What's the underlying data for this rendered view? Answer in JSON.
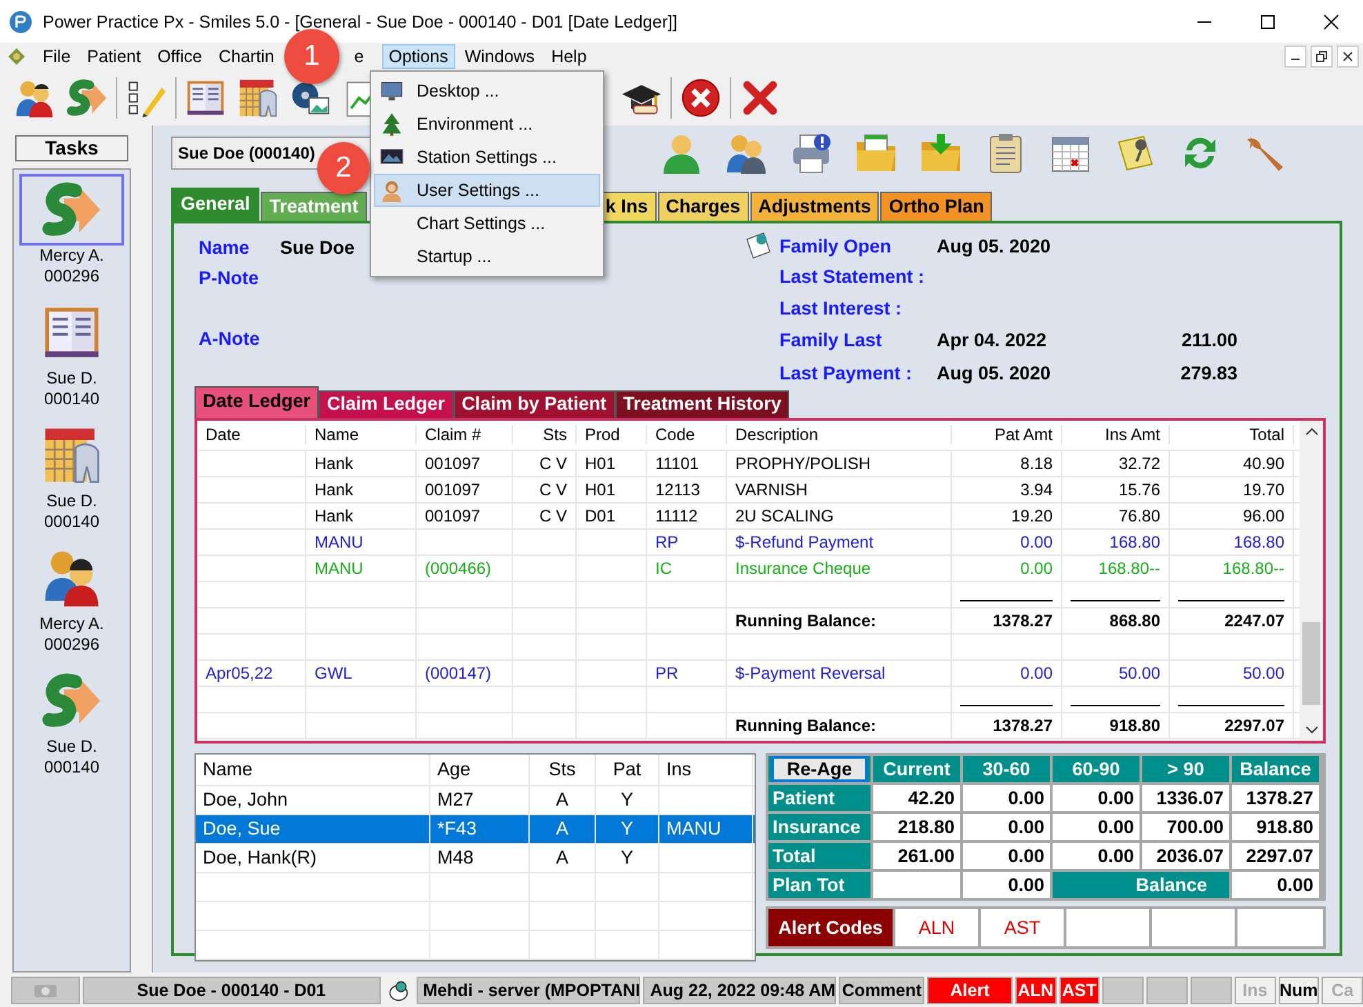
{
  "window": {
    "title": "Power Practice Px - Smiles 5.0 - [General - Sue Doe - 000140 - D01 [Date Ledger]]"
  },
  "menu": [
    {
      "label": "File",
      "selected": false
    },
    {
      "label": "Patient",
      "selected": false
    },
    {
      "label": "Office",
      "selected": false
    },
    {
      "label": "Chartin",
      "selected": false
    },
    {
      "label": "e",
      "selected": false
    },
    {
      "label": "Options",
      "selected": true
    },
    {
      "label": "Windows",
      "selected": false
    },
    {
      "label": "Help",
      "selected": false
    }
  ],
  "options_menu": {
    "items": [
      {
        "label": "Desktop ...",
        "selected": false
      },
      {
        "label": "Environment ...",
        "selected": false
      },
      {
        "label": "Station Settings ...",
        "selected": false
      },
      {
        "label": "User Settings ...",
        "selected": true
      },
      {
        "label": "Chart Settings ...",
        "selected": false
      },
      {
        "label": "Startup ...",
        "selected": false
      }
    ]
  },
  "callouts": [
    {
      "number": "1"
    },
    {
      "number": "2"
    }
  ],
  "tasks": {
    "title": "Tasks",
    "items": [
      {
        "kind": "payment",
        "name": "Mercy A.",
        "number": "000296",
        "selected": true
      },
      {
        "kind": "ledger",
        "name": "Sue D.",
        "number": "000140",
        "selected": false
      },
      {
        "kind": "chart",
        "name": "Sue D.",
        "number": "000140",
        "selected": false
      },
      {
        "kind": "family",
        "name": "Mercy A.",
        "number": "000296",
        "selected": false
      },
      {
        "kind": "payment",
        "name": "Sue D.",
        "number": "000140",
        "selected": false
      }
    ]
  },
  "patient_select": {
    "value": "Sue Doe (000140)"
  },
  "tabs": [
    {
      "label": "General",
      "selected": true,
      "color": "#2e8b2e"
    },
    {
      "label": "Treatment",
      "selected": false,
      "color": "#62ad52"
    },
    {
      "label": "k Ins",
      "selected": false,
      "color": "#f0d860"
    },
    {
      "label": "Charges",
      "selected": false,
      "color": "#f0d060"
    },
    {
      "label": "Adjustments",
      "selected": false,
      "color": "#f5b23a"
    },
    {
      "label": "Ortho Plan",
      "selected": false,
      "color": "#f39224"
    }
  ],
  "patient_info": {
    "name_label": "Name",
    "name": "Sue Doe",
    "p_note_label": "P-Note",
    "a_note_label": "A-Note",
    "summary": [
      {
        "label": "Family Open",
        "date": "Aug 05. 2020"
      },
      {
        "label": "Last Statement :"
      },
      {
        "label": "Last Interest :"
      },
      {
        "label": "Family Last",
        "date": "Apr 04. 2022",
        "amount": "211.00"
      },
      {
        "label": "Last Payment :",
        "date": "Aug 05. 2020",
        "amount": "279.83"
      }
    ]
  },
  "ledger_tabs": [
    {
      "label": "Date Ledger",
      "selected": true,
      "color": "#e8507c"
    },
    {
      "label": "Claim Ledger",
      "selected": false,
      "color": "#c4104c"
    },
    {
      "label": "Claim by Patient",
      "selected": false,
      "color": "#a01030"
    },
    {
      "label": "Treatment History",
      "selected": false,
      "color": "#7c1020"
    }
  ],
  "ledger": {
    "columns": [
      "Date",
      "Name",
      "Claim #",
      "Sts",
      "Prod",
      "Code",
      "Description",
      "Pat Amt",
      "Ins Amt",
      "Total"
    ],
    "rows": [
      {
        "kind": "entry",
        "color": "#000000",
        "name": "Hank",
        "claim": "001097",
        "sts": "C V",
        "prod": "H01",
        "code": "11101",
        "description": "PROPHY/POLISH",
        "pat": "8.18",
        "ins": "32.72",
        "total": "40.90"
      },
      {
        "kind": "entry",
        "color": "#000000",
        "name": "Hank",
        "claim": "001097",
        "sts": "C V",
        "prod": "H01",
        "code": "12113",
        "description": "VARNISH",
        "pat": "3.94",
        "ins": "15.76",
        "total": "19.70"
      },
      {
        "kind": "entry",
        "color": "#000000",
        "name": "Hank",
        "claim": "001097",
        "sts": "C V",
        "prod": "D01",
        "code": "11112",
        "description": "2U SCALING",
        "pat": "19.20",
        "ins": "76.80",
        "total": "96.00"
      },
      {
        "kind": "entry",
        "color": "#2020d0",
        "name": "MANU",
        "code": "RP",
        "description": "$-Refund Payment",
        "pat": "0.00",
        "ins": "168.80",
        "total": "168.80"
      },
      {
        "kind": "entry",
        "color": "#18b018",
        "name": "MANU",
        "claim": "(000466)",
        "code": "IC",
        "description": "Insurance Cheque",
        "pat": "0.00",
        "ins": "168.80--",
        "total": "168.80--"
      },
      {
        "kind": "rule"
      },
      {
        "kind": "total",
        "description": "Running Balance:",
        "pat": "1378.27",
        "ins": "868.80",
        "total": "2247.07"
      },
      {
        "kind": "blank"
      },
      {
        "kind": "entry",
        "color": "#2020d0",
        "date": "Apr05,22",
        "name": "GWL",
        "claim": "(000147)",
        "code": "PR",
        "description": "$-Payment Reversal",
        "pat": "0.00",
        "ins": "50.00",
        "total": "50.00"
      },
      {
        "kind": "rule"
      },
      {
        "kind": "total",
        "description": "Running Balance:",
        "pat": "1378.27",
        "ins": "918.80",
        "total": "2297.07"
      }
    ]
  },
  "family": {
    "columns": [
      "Name",
      "Age",
      "Sts",
      "Pat",
      "Ins"
    ],
    "rows": [
      {
        "name": "Doe, John",
        "age": "M27",
        "sts": "A",
        "pat": "Y",
        "selected": false
      },
      {
        "name": "Doe, Sue",
        "age": "*F43",
        "sts": "A",
        "pat": "Y",
        "ins": "MANU",
        "selected": true
      },
      {
        "name": "Doe, Hank(R)",
        "age": "M48",
        "sts": "A",
        "pat": "Y",
        "selected": false
      }
    ]
  },
  "aging": {
    "button": "Re-Age",
    "columns": [
      "Current",
      "30-60",
      "60-90",
      "> 90",
      "Balance"
    ],
    "rows": [
      {
        "label": "Patient",
        "values": [
          "42.20",
          "0.00",
          "0.00",
          "1336.07",
          "1378.27"
        ]
      },
      {
        "label": "Insurance",
        "values": [
          "218.80",
          "0.00",
          "0.00",
          "700.00",
          "918.80"
        ]
      },
      {
        "label": "Total",
        "values": [
          "261.00",
          "0.00",
          "0.00",
          "2036.07",
          "2297.07"
        ]
      }
    ],
    "plan": {
      "label": "Plan Tot",
      "value": "0.00",
      "balance_label": "Balance",
      "balance": "0.00"
    }
  },
  "alerts": {
    "label": "Alert Codes",
    "codes": [
      "ALN",
      "AST"
    ]
  },
  "status_bar": {
    "patient": "Sue Doe - 000140 - D01",
    "user": "Mehdi - server (MPOPTANI",
    "datetime": "Aug 22, 2022 09:48 AM",
    "comment": "Comment",
    "alert": "Alert",
    "codes": [
      "ALN",
      "AST"
    ],
    "keys": [
      {
        "label": "Ins",
        "on": false
      },
      {
        "label": "Num",
        "on": true
      },
      {
        "label": "Ca",
        "on": false
      }
    ]
  }
}
